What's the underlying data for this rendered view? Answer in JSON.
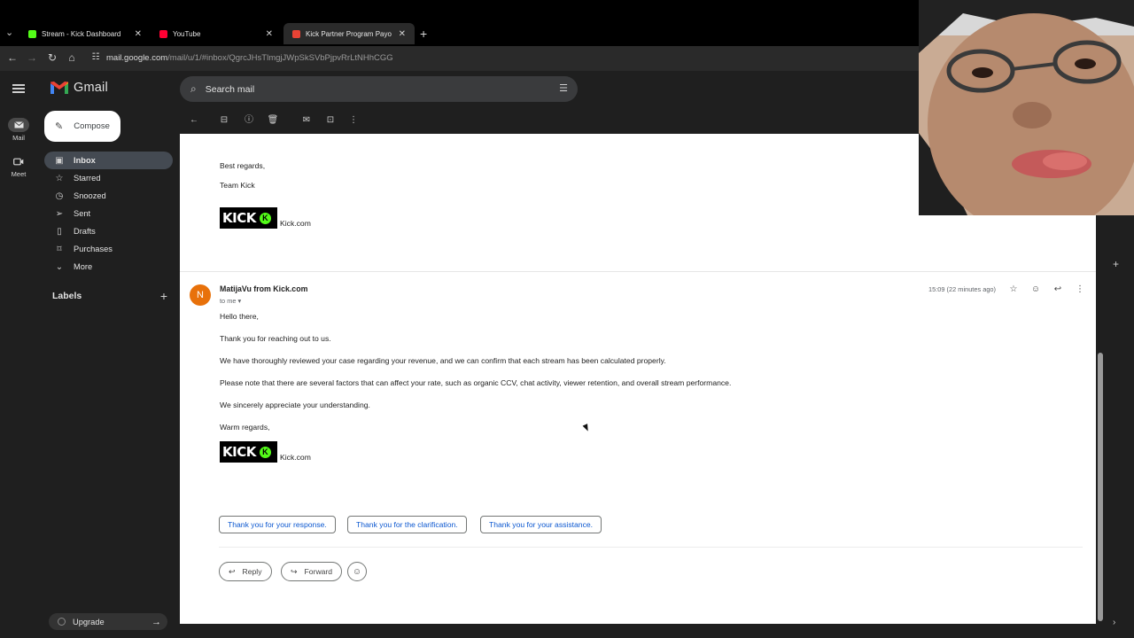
{
  "browser": {
    "tabs": [
      {
        "title": "Stream - Kick Dashboard",
        "favicon_color": "#53fc18",
        "active": false
      },
      {
        "title": "YouTube",
        "favicon_color": "#ff0033",
        "active": false
      },
      {
        "title": "Kick Partner Program Payout Er",
        "favicon_color": "#ea4335",
        "active": true
      }
    ],
    "url_host": "mail.google.com",
    "url_path": "/mail/u/1/#inbox/QgrcJHsTlmgjJWpSkSVbPjpvRrLtNHhCGG"
  },
  "gmail": {
    "app_name": "Gmail",
    "rail": [
      {
        "label": "Mail",
        "icon": "mail-icon"
      },
      {
        "label": "Meet",
        "icon": "video-icon"
      }
    ],
    "compose_label": "Compose",
    "search_placeholder": "Search mail",
    "nav": [
      {
        "label": "Inbox",
        "icon": "inbox-icon",
        "selected": true
      },
      {
        "label": "Starred",
        "icon": "star-icon"
      },
      {
        "label": "Snoozed",
        "icon": "clock-icon"
      },
      {
        "label": "Sent",
        "icon": "send-icon"
      },
      {
        "label": "Drafts",
        "icon": "draft-icon"
      },
      {
        "label": "Purchases",
        "icon": "tag-icon"
      },
      {
        "label": "More",
        "icon": "chevron-down-icon"
      }
    ],
    "labels_heading": "Labels",
    "upgrade_label": "Upgrade"
  },
  "thread": {
    "prev_message": {
      "closing": "Best regards,",
      "signature": "Team Kick",
      "logo_text": "KICK",
      "link_text": "Kick.com"
    },
    "message": {
      "avatar_letter": "N",
      "sender": "MatijaVu from Kick.com",
      "recipient": "to me",
      "timestamp": "15:09 (22 minutes ago)",
      "greeting": "Hello there,",
      "para1": "Thank you for reaching out to us.",
      "para2": "We have thoroughly reviewed your case regarding your revenue, and we can confirm that each stream has been calculated properly.",
      "para3": "Please note that there are several factors that can affect your rate, such as organic CCV, chat activity, viewer retention, and overall stream performance.",
      "para4": "We sincerely appreciate your understanding.",
      "closing": "Warm regards,",
      "logo_text": "KICK",
      "link_text": "Kick.com"
    },
    "smart_replies": [
      "Thank you for your response.",
      "Thank you for the clarification.",
      "Thank you for your assistance."
    ],
    "reply_label": "Reply",
    "forward_label": "Forward"
  }
}
